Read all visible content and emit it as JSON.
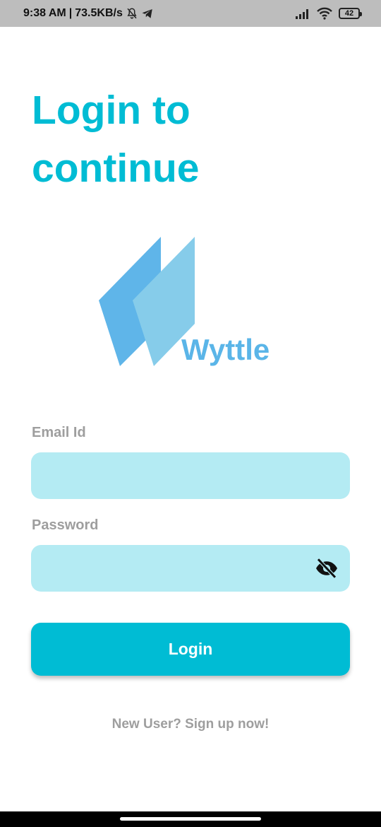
{
  "status_bar": {
    "time": "9:38 AM",
    "separator": "|",
    "net_speed": "73.5KB/s",
    "battery": "42"
  },
  "title": {
    "line1": "Login to",
    "line2": "continue"
  },
  "logo": {
    "text": "Wyttle",
    "colors": {
      "back_panel": "#5fb5e9",
      "front_panel": "#86ccea",
      "text": "#5ab5e8"
    }
  },
  "form": {
    "email_label": "Email Id",
    "email_value": "",
    "password_label": "Password",
    "password_value": "",
    "password_toggle_icon": "eye-off-icon",
    "login_button": "Login"
  },
  "signup": {
    "text": "New User? Sign up now!"
  },
  "colors": {
    "accent": "#00bcd4",
    "input_bg": "#b4ebf3",
    "label": "#9e9e9e"
  }
}
